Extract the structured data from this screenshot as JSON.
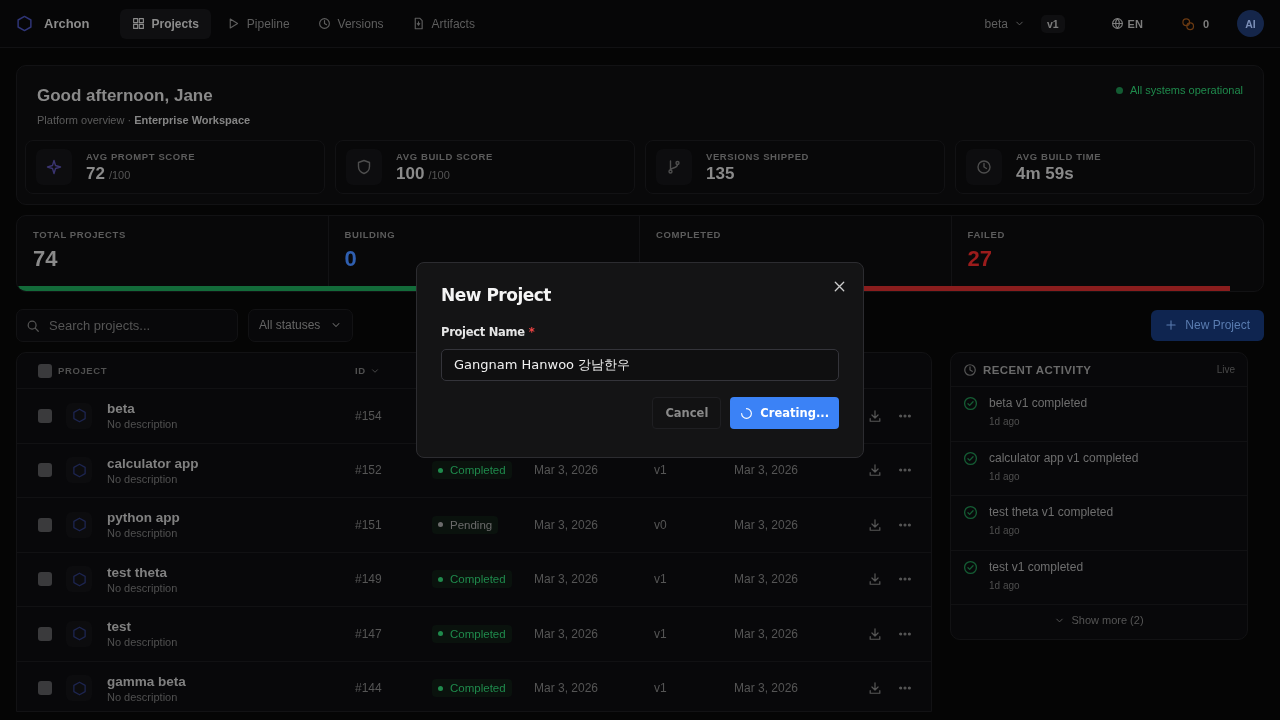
{
  "topbar": {
    "brand": "Archon",
    "nav": [
      {
        "label": "Projects",
        "selected": true
      },
      {
        "label": "Pipeline",
        "selected": false
      },
      {
        "label": "Versions",
        "selected": false
      },
      {
        "label": "Artifacts",
        "selected": false
      }
    ],
    "environment": "beta",
    "version": "v1",
    "language": "EN",
    "notifications": "0",
    "avatar": "AI"
  },
  "overview": {
    "greeting": "Good afternoon, Jane",
    "subtitle": "Platform overview · **Enterprise Workspace**",
    "status": "All systems operational",
    "stats": [
      {
        "label": "AVG PROMPT SCORE",
        "value": "72",
        "suffix": "/100"
      },
      {
        "label": "AVG BUILD SCORE",
        "value": "100",
        "suffix": "/100"
      },
      {
        "label": "VERSIONS SHIPPED",
        "value": "135"
      },
      {
        "label": "AVG BUILD TIME",
        "value": "4m 59s"
      }
    ]
  },
  "counts": {
    "items": [
      {
        "label": "TOTAL PROJECTS",
        "value": "74",
        "color": "#8a8a8a"
      },
      {
        "label": "BUILDING",
        "value": "0",
        "color": "#2f5fb0"
      },
      {
        "label": "COMPLETED"
      },
      {
        "label": "FAILED",
        "value": "27",
        "color": "#9b1c1c"
      }
    ],
    "bar": [
      {
        "color": "#136b3a",
        "level": 0.62
      },
      {
        "color": "#8a1d1d",
        "level": 0.36
      }
    ]
  },
  "toolbar": {
    "search_placeholder": "Search projects...",
    "status_filter": "All statuses",
    "new_button": "New Project"
  },
  "table": {
    "columns": [
      "PROJECT",
      "ID"
    ],
    "select_all_checked": false,
    "rows": [
      {
        "checked": false,
        "name": "beta",
        "description": "No description",
        "id": "#154"
      },
      {
        "checked": false,
        "name": "calculator app",
        "description": "No description",
        "id": "#152",
        "status": "Completed",
        "color": "#1f8a4c",
        "created": "Mar 3, 2026",
        "version": "v1",
        "updated": "Mar 3, 2026"
      },
      {
        "checked": false,
        "name": "python app",
        "description": "No description",
        "id": "#151",
        "status": "Pending",
        "color": "#6b6b6b",
        "created": "Mar 3, 2026",
        "version": "v0",
        "updated": "Mar 3, 2026"
      },
      {
        "checked": false,
        "name": "test theta",
        "description": "No description",
        "id": "#149",
        "status": "Completed",
        "color": "#1f8a4c",
        "created": "Mar 3, 2026",
        "version": "v1",
        "updated": "Mar 3, 2026"
      },
      {
        "checked": false,
        "name": "test",
        "description": "No description",
        "id": "#147",
        "status": "Completed",
        "color": "#1f8a4c",
        "created": "Mar 3, 2026",
        "version": "v1",
        "updated": "Mar 3, 2026"
      },
      {
        "checked": false,
        "name": "gamma beta",
        "description": "No description",
        "id": "#144",
        "status": "Completed",
        "color": "#1f8a4c",
        "created": "Mar 3, 2026",
        "version": "v1",
        "updated": "Mar 3, 2026"
      }
    ]
  },
  "activity": {
    "title": "RECENT ACTIVITY",
    "live": "Live",
    "items": [
      {
        "text": "beta v1 completed",
        "time": "1d ago"
      },
      {
        "text": "calculator app v1 completed",
        "time": "1d ago"
      },
      {
        "text": "test theta v1 completed",
        "time": "1d ago"
      },
      {
        "text": "test v1 completed",
        "time": "1d ago"
      }
    ],
    "show_more": "Show more (2)"
  },
  "modal": {
    "title": "New Project",
    "field_label": "Project Name",
    "required_mark": "*",
    "value": "Gangnam Hanwoo 강남한우",
    "cancel": "Cancel",
    "submit": "Creating...",
    "loading": true
  }
}
